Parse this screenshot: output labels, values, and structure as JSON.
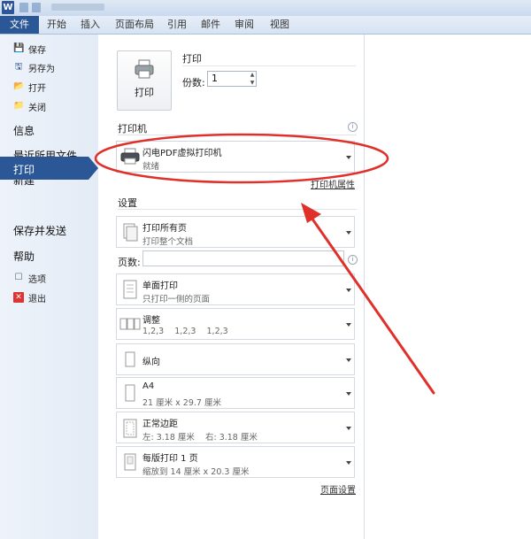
{
  "ribbon": {
    "tabs": [
      "文件",
      "开始",
      "插入",
      "页面布局",
      "引用",
      "邮件",
      "审阅",
      "视图"
    ]
  },
  "nav": {
    "save": "保存",
    "save_as": "另存为",
    "open": "打开",
    "close": "关闭",
    "info": "信息",
    "recent": "最近所用文件",
    "new": "新建",
    "print": "打印",
    "save_send": "保存并发送",
    "help": "帮助",
    "options": "选项",
    "exit": "退出"
  },
  "print": {
    "button_label": "打印",
    "heading": "打印",
    "copies_label": "份数:",
    "copies_value": "1"
  },
  "printer": {
    "section_title": "打印机",
    "name": "闪电PDF虚拟打印机",
    "status": "就绪",
    "properties_link": "打印机属性"
  },
  "settings": {
    "section_title": "设置",
    "pages_label": "页数:",
    "items": [
      {
        "main": "打印所有页",
        "sub": "打印整个文档"
      },
      {
        "main": "单面打印",
        "sub": "只打印一侧的页面"
      },
      {
        "main": "调整",
        "sub": "1,2,3    1,2,3    1,2,3"
      },
      {
        "main": "纵向",
        "sub": ""
      },
      {
        "main": "A4",
        "sub": "21 厘米 x 29.7 厘米"
      },
      {
        "main": "正常边距",
        "sub": "左: 3.18 厘米    右: 3.18 厘米"
      },
      {
        "main": "每版打印 1 页",
        "sub": "缩放到 14 厘米 x 20.3 厘米"
      }
    ],
    "page_setup_link": "页面设置"
  },
  "colors": {
    "accent": "#2b5797",
    "annotation_red": "#e0302a"
  }
}
